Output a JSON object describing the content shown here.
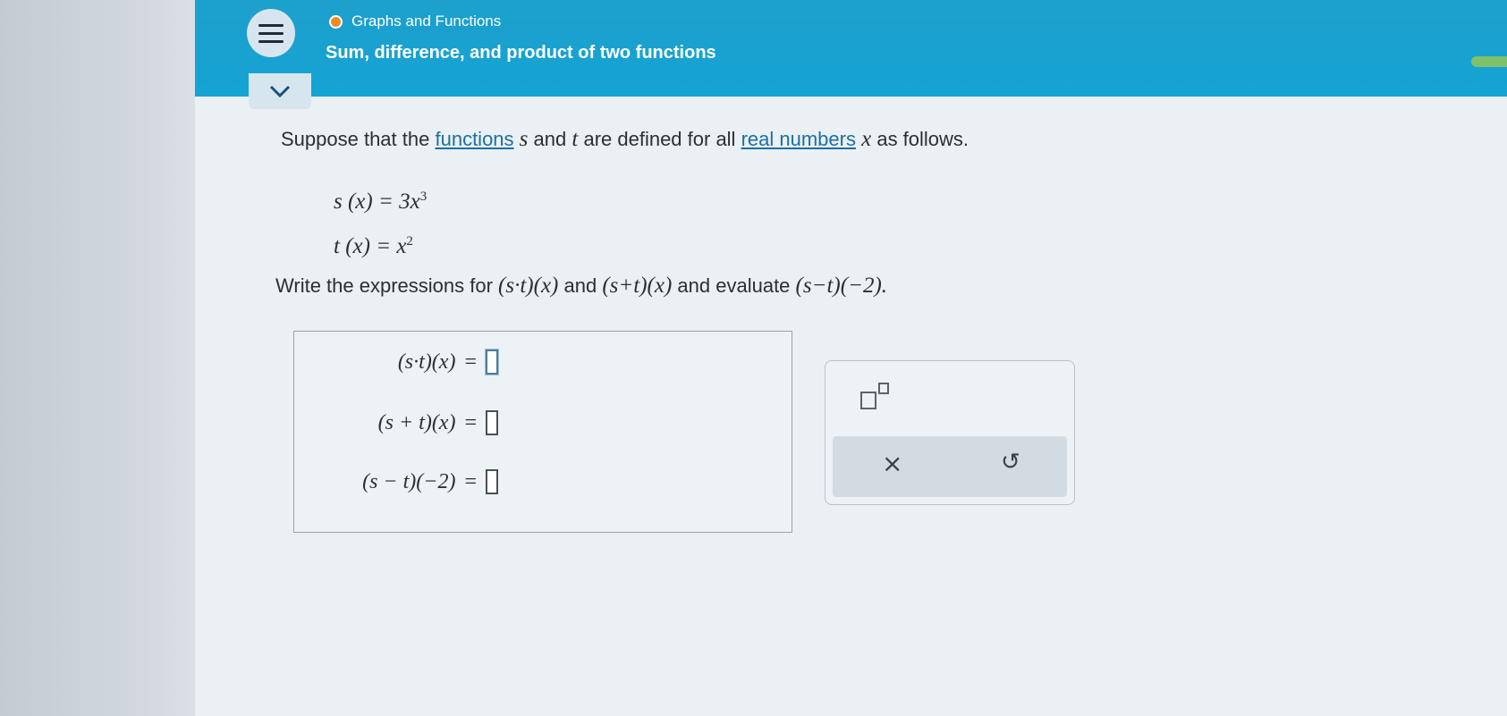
{
  "header": {
    "breadcrumb": "Graphs and Functions",
    "title": "Sum, difference, and product of two functions"
  },
  "icons": {
    "menu": "hamburger-menu-icon",
    "collapse": "chevron-down-icon",
    "status_dot_color": "#f08a23"
  },
  "problem": {
    "intro_1": "Suppose that the",
    "link_functions": "functions",
    "var_s": "s",
    "intro_2": "and",
    "var_t": "t",
    "intro_3": "are defined for all",
    "link_real_numbers": "real numbers",
    "var_x": "x",
    "intro_4": "as follows.",
    "def_s": "s (x) = 3x",
    "def_s_exp": "3",
    "def_t": "t (x) = x",
    "def_t_exp": "2",
    "instr_1": "Write the expressions for",
    "expr_product": "(s·t)(x)",
    "instr_2": "and",
    "expr_sum": "(s+t)(x)",
    "instr_3": "and evaluate",
    "expr_diff": "(s−t)(−2).",
    "rows": [
      {
        "expr": "(s·t)(x)",
        "eq": "="
      },
      {
        "expr": "(s + t)(x)",
        "eq": "="
      },
      {
        "expr": "(s − t)(−2)",
        "eq": "="
      }
    ]
  },
  "tools": {
    "exponent_icon": "exponent-template-icon",
    "clear_symbol": "×",
    "undo_symbol": "↺"
  }
}
